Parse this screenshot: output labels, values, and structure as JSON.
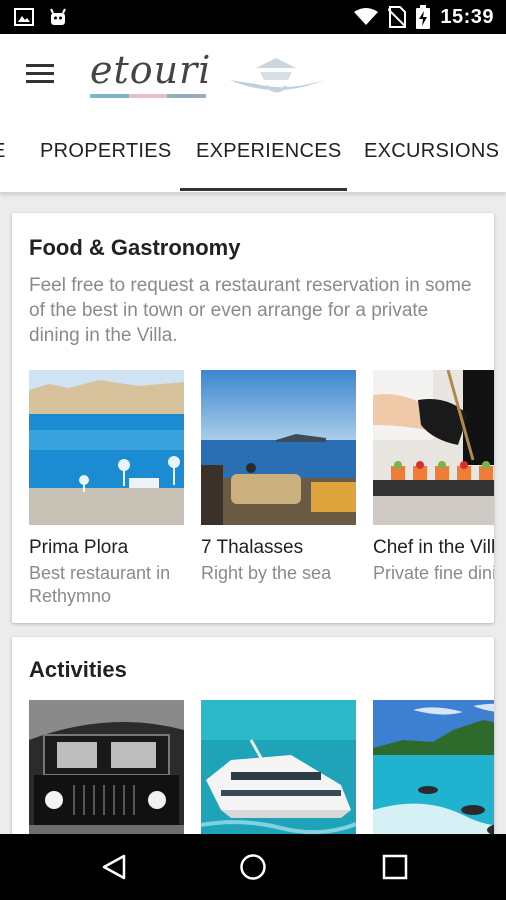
{
  "status_bar": {
    "time": "15:39",
    "icons": [
      "image-icon",
      "android-icon",
      "wifi-icon",
      "no-sim-icon",
      "battery-charging-icon"
    ]
  },
  "app_bar": {
    "logo_text": "etouri",
    "menu_icon": "hamburger-menu-icon",
    "logo_colors": [
      "#7fb4c8",
      "#e7c1c3",
      "#9aaab8"
    ]
  },
  "tabs": [
    {
      "label": "E",
      "active": false
    },
    {
      "label": "PROPERTIES",
      "active": false
    },
    {
      "label": "EXPERIENCES",
      "active": true
    },
    {
      "label": "EXCURSIONS",
      "active": false
    }
  ],
  "sections": {
    "food": {
      "title": "Food & Gastronomy",
      "description": "Feel free to request a restaurant reservation in some of the best in town or even arrange for a private dining in the Villa.",
      "items": [
        {
          "name": "Prima Plora",
          "subtitle": "Best restaurant in Rethymno"
        },
        {
          "name": "7 Thalasses",
          "subtitle": "Right by the sea"
        },
        {
          "name": "Chef in the Vill",
          "subtitle": "Private fine dining"
        }
      ]
    },
    "activities": {
      "title": "Activities",
      "items": [
        {
          "image": "off-road-jeep"
        },
        {
          "image": "yacht"
        },
        {
          "image": "jet-ski"
        }
      ]
    }
  },
  "nav_bar": {
    "buttons": [
      "back-icon",
      "home-icon",
      "recents-icon"
    ]
  },
  "colors": {
    "accent": "#333333",
    "background": "#ececec",
    "secondary_text": "#8a8a8a"
  }
}
